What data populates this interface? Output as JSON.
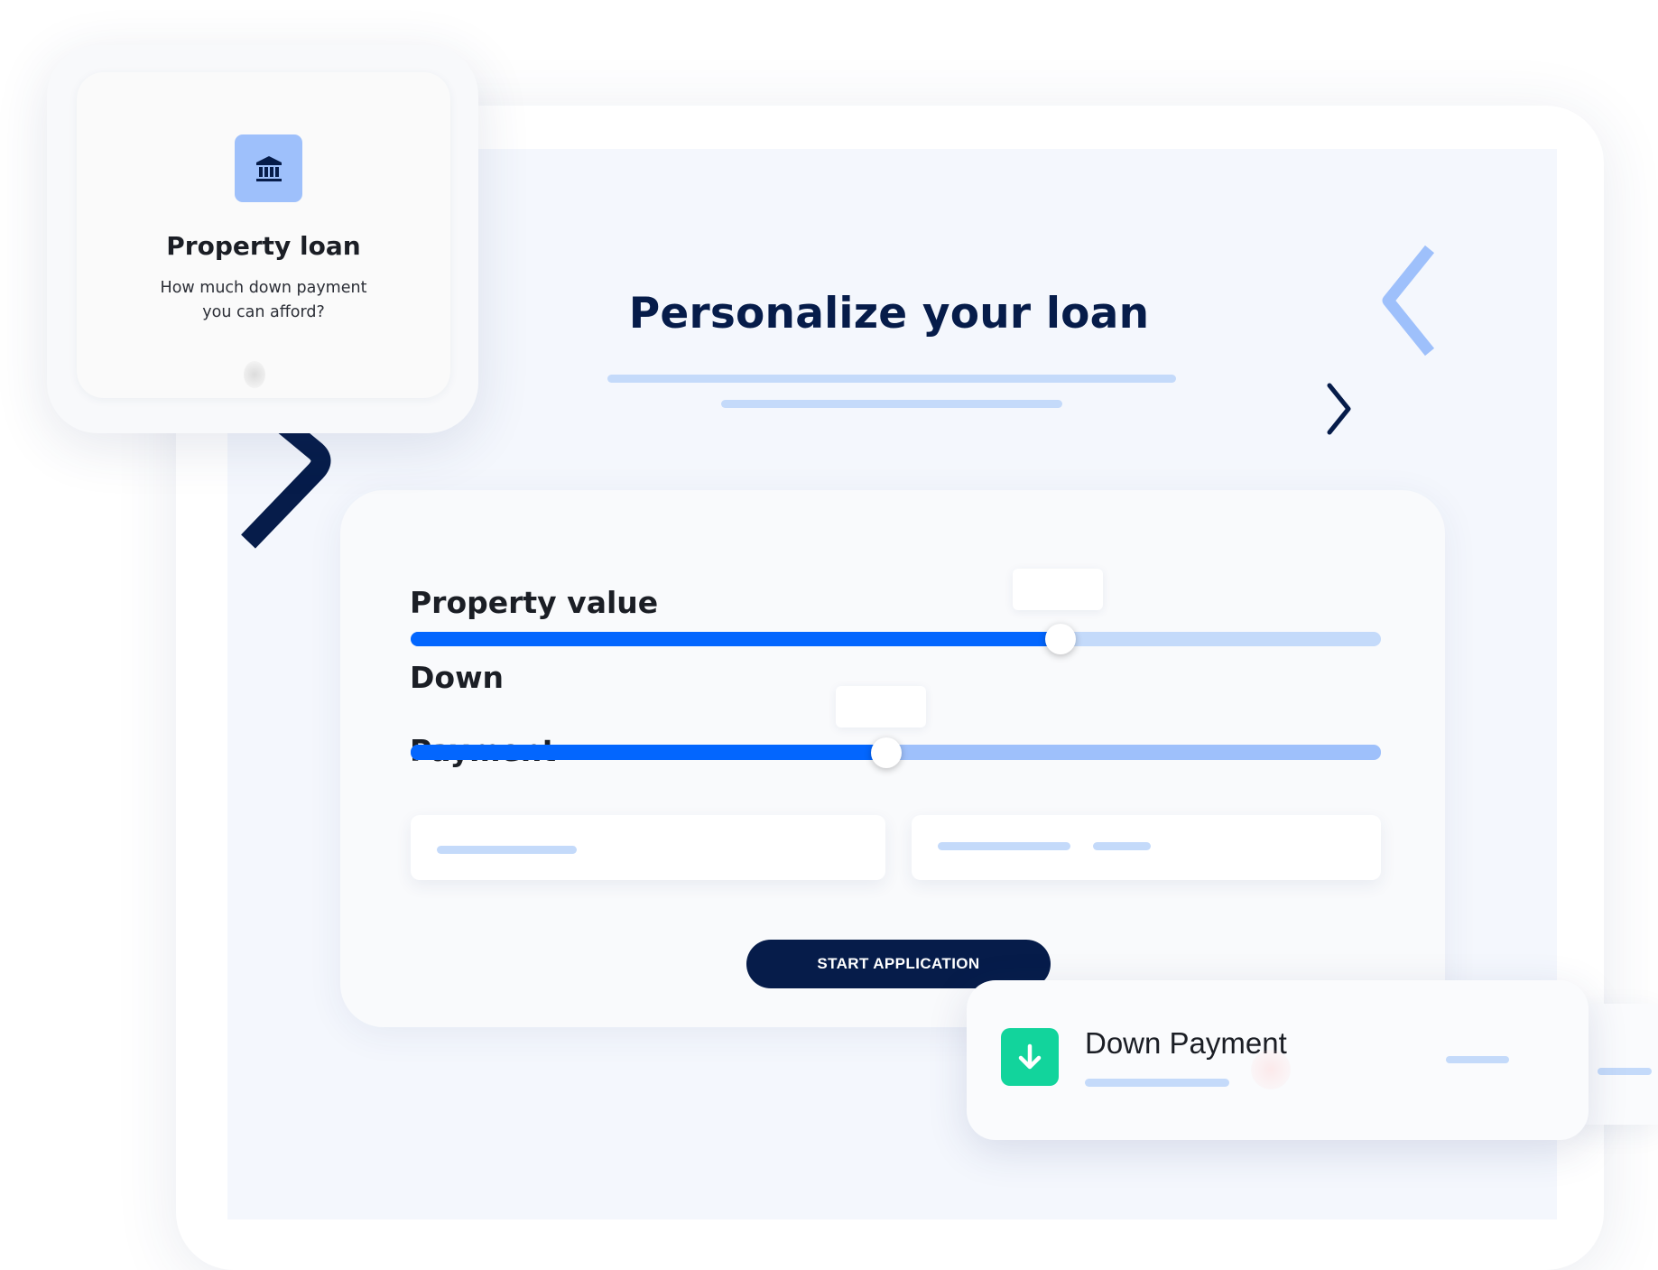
{
  "main": {
    "title": "Personalize your loan",
    "form": {
      "property_value": {
        "label": "Property value",
        "level_percent": 67
      },
      "down_payment": {
        "label_line1": "Down",
        "label_line2": "Payment",
        "level_percent": 49
      },
      "cta_label": "START APPLICATION"
    }
  },
  "property_card": {
    "icon": "bank-icon",
    "title": "Property loan",
    "subtitle_line1": "How much down payment",
    "subtitle_line2": "you can afford?"
  },
  "notification": {
    "icon": "arrow-down-icon",
    "title": "Down Payment"
  },
  "colors": {
    "navy": "#061c4a",
    "primary_blue": "#0366fe",
    "light_blue": "#c4dafa",
    "accent_green": "#12d49c",
    "icon_tile_blue": "#9ec0fb"
  }
}
